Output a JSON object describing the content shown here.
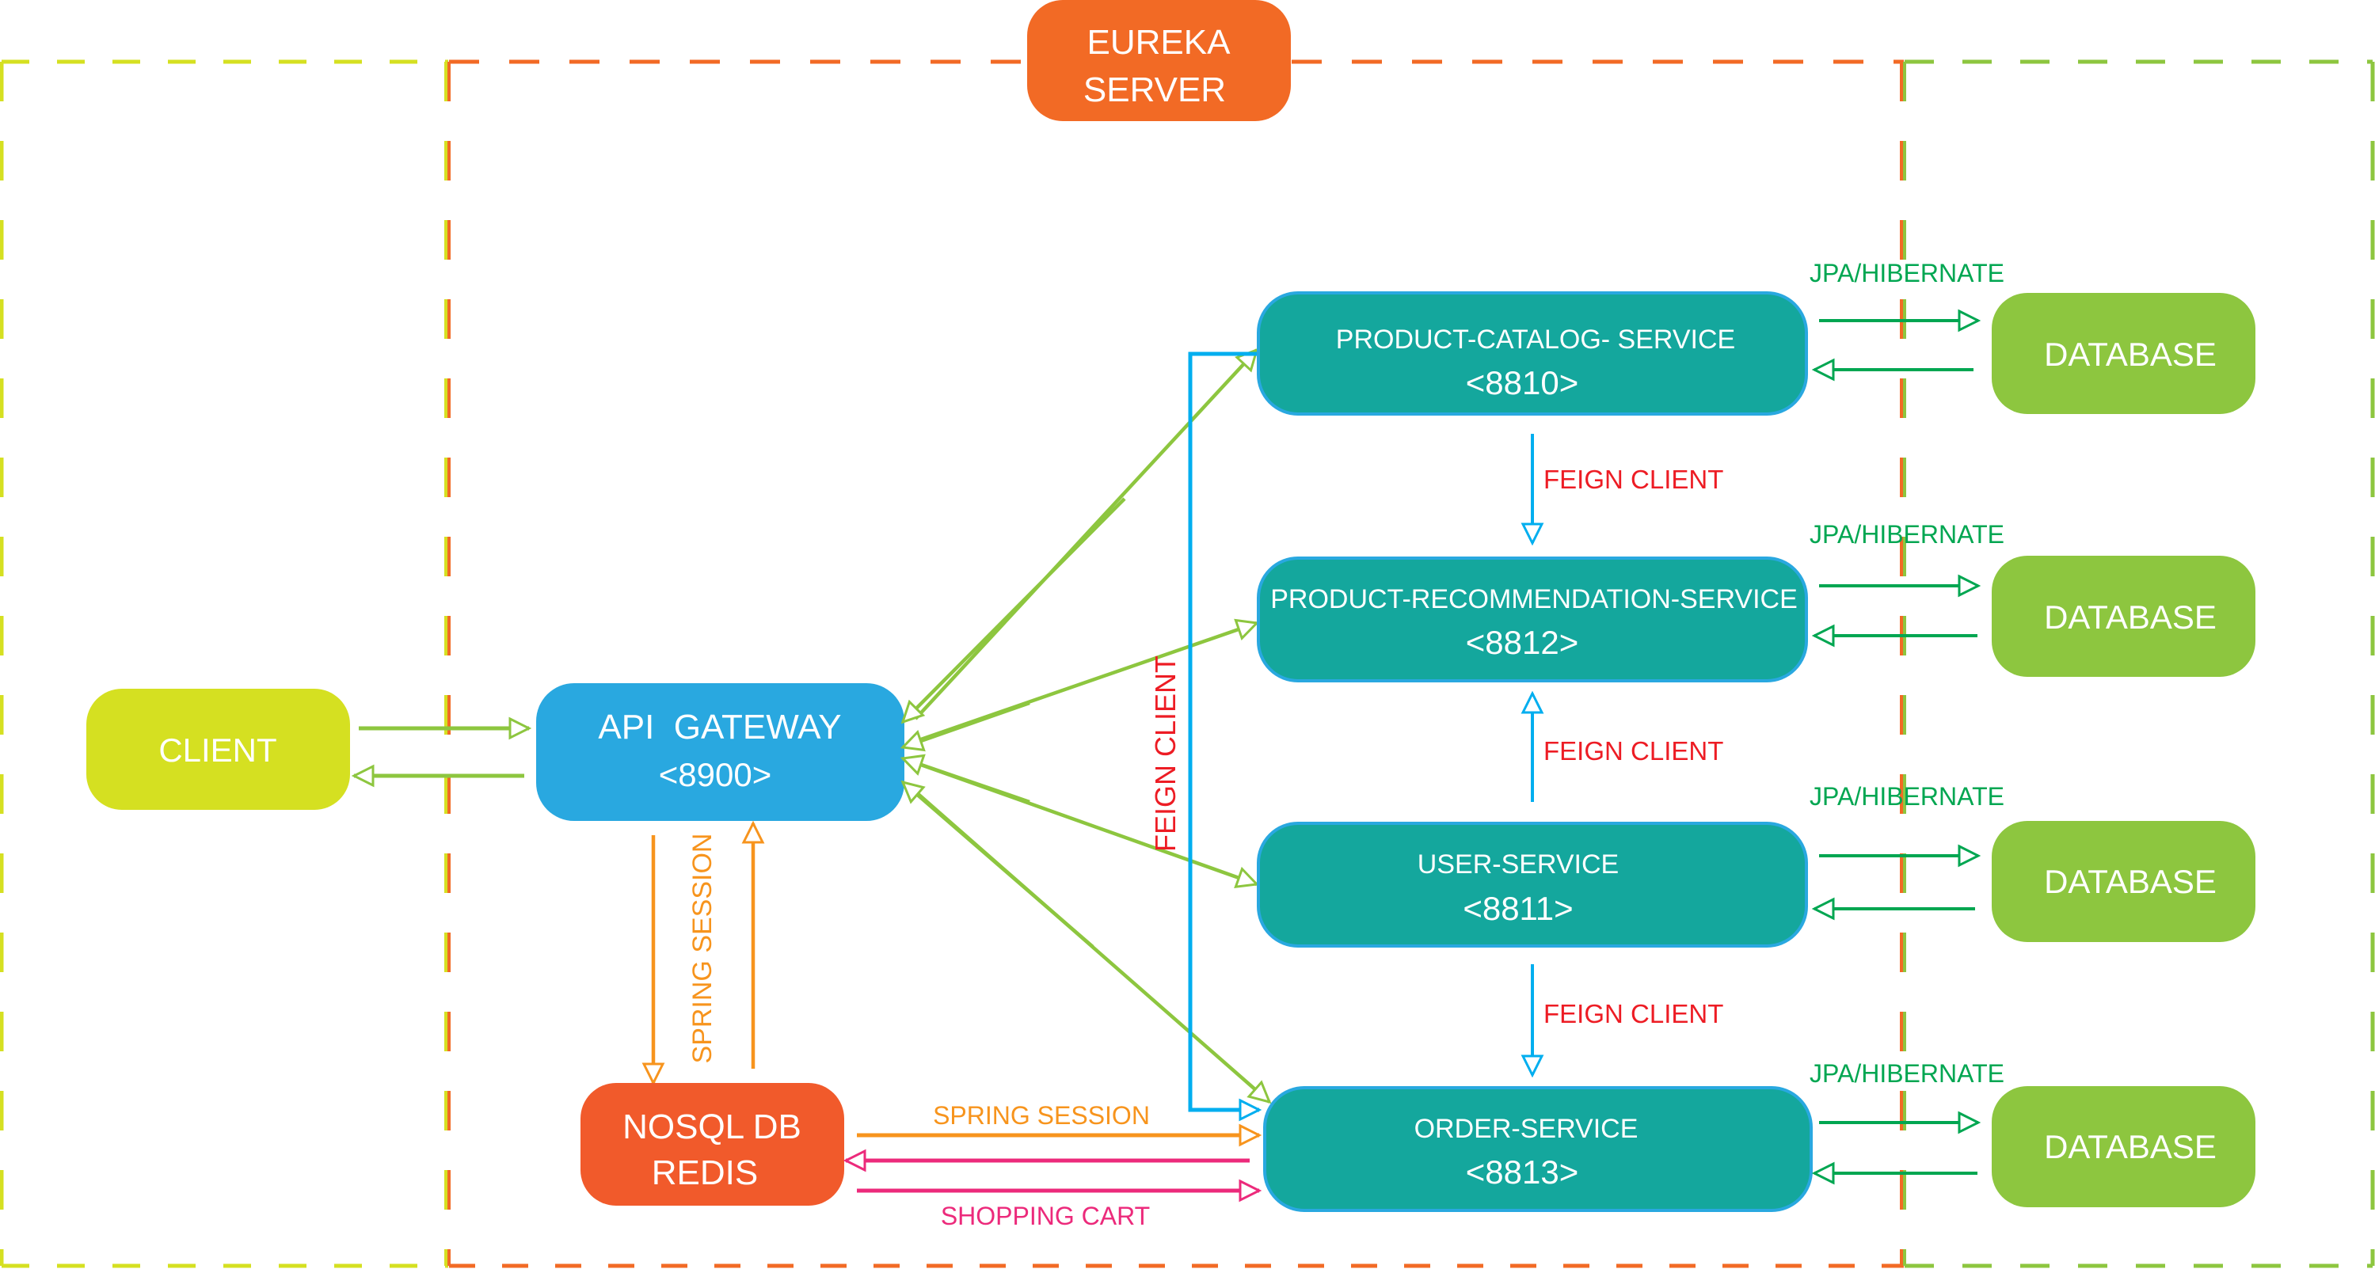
{
  "colors": {
    "eureka": "#f26a25",
    "client": "#d5e021",
    "gateway": "#29a8e0",
    "service_fill": "#14a79d",
    "service_border": "#29a8e0",
    "database": "#8dc63f",
    "nosql": "#f15a2b",
    "zone_client": "#d5e021",
    "zone_eureka": "#f26a25",
    "zone_db": "#8dc63f",
    "gateway_link": "#8dc63f",
    "feign_line": "#00aeef",
    "feign_text": "#ed1c24",
    "jpa": "#00a651",
    "spring_session": "#f7941d",
    "shopping_cart": "#ec2a7b"
  },
  "eureka": {
    "line1": "EUREKA",
    "line2": "SERVER"
  },
  "client": {
    "label": "CLIENT"
  },
  "gateway": {
    "name": "API  GATEWAY",
    "port": "<8900>"
  },
  "nosql": {
    "line1": "NOSQL DB",
    "line2": "REDIS"
  },
  "services": [
    {
      "name": "PRODUCT-CATALOG- SERVICE",
      "port": "<8810>"
    },
    {
      "name": "PRODUCT-RECOMMENDATION-SERVICE",
      "port": "<8812>"
    },
    {
      "name": "USER-SERVICE",
      "port": "<8811>"
    },
    {
      "name": "ORDER-SERVICE",
      "port": "<8813>"
    }
  ],
  "databases": [
    {
      "label": "DATABASE",
      "link_label": "JPA/HIBERNATE"
    },
    {
      "label": "DATABASE",
      "link_label": "JPA/HIBERNATE"
    },
    {
      "label": "DATABASE",
      "link_label": "JPA/HIBERNATE"
    },
    {
      "label": "DATABASE",
      "link_label": "JPA/HIBERNATE"
    }
  ],
  "links": {
    "feign_catalog_to_recommendation": "FEIGN CLIENT",
    "feign_user_to_recommendation": "FEIGN CLIENT",
    "feign_user_to_order": "FEIGN CLIENT",
    "feign_catalog_to_order_vertical": "FEIGN CLIENT",
    "gateway_redis_session": "SPRING SESSION",
    "order_redis_session": "SPRING SESSION",
    "order_redis_cart": "SHOPPING CART"
  }
}
